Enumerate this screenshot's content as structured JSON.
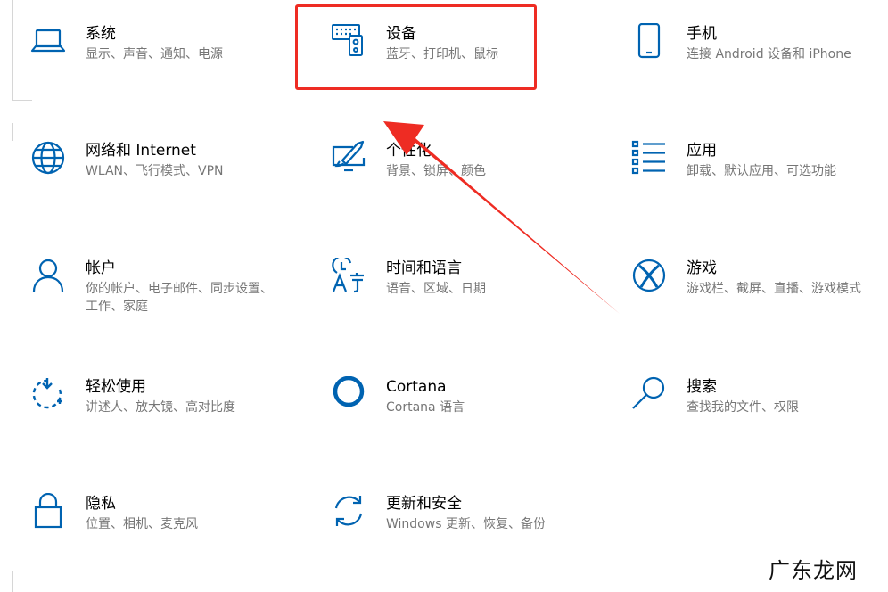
{
  "tiles": [
    {
      "key": "system",
      "title": "系统",
      "desc": "显示、声音、通知、电源",
      "icon": "laptop-icon"
    },
    {
      "key": "devices",
      "title": "设备",
      "desc": "蓝牙、打印机、鼠标",
      "icon": "devices-icon"
    },
    {
      "key": "phone",
      "title": "手机",
      "desc": "连接 Android 设备和 iPhone",
      "icon": "phone-icon"
    },
    {
      "key": "network",
      "title": "网络和 Internet",
      "desc": "WLAN、飞行模式、VPN",
      "icon": "globe-icon"
    },
    {
      "key": "personalization",
      "title": "个性化",
      "desc": "背景、锁屏、颜色",
      "icon": "brush-icon"
    },
    {
      "key": "apps",
      "title": "应用",
      "desc": "卸载、默认应用、可选功能",
      "icon": "apps-list-icon"
    },
    {
      "key": "accounts",
      "title": "帐户",
      "desc": "你的帐户、电子邮件、同步设置、工作、家庭",
      "icon": "person-icon"
    },
    {
      "key": "time-language",
      "title": "时间和语言",
      "desc": "语音、区域、日期",
      "icon": "time-language-icon"
    },
    {
      "key": "gaming",
      "title": "游戏",
      "desc": "游戏栏、截屏、直播、游戏模式",
      "icon": "xbox-icon"
    },
    {
      "key": "ease-of-access",
      "title": "轻松使用",
      "desc": "讲述人、放大镜、高对比度",
      "icon": "ease-of-access-icon"
    },
    {
      "key": "cortana",
      "title": "Cortana",
      "desc": "Cortana 语言",
      "icon": "cortana-icon"
    },
    {
      "key": "search",
      "title": "搜索",
      "desc": "查找我的文件、权限",
      "icon": "search-icon"
    },
    {
      "key": "privacy",
      "title": "隐私",
      "desc": "位置、相机、麦克风",
      "icon": "lock-icon"
    },
    {
      "key": "update-security",
      "title": "更新和安全",
      "desc": "Windows 更新、恢复、备份",
      "icon": "sync-icon"
    }
  ],
  "watermark": "广东龙网",
  "colors": {
    "accent": "#0063b1",
    "annotation": "#ee2c23",
    "title": "#000000",
    "description": "#767676"
  }
}
